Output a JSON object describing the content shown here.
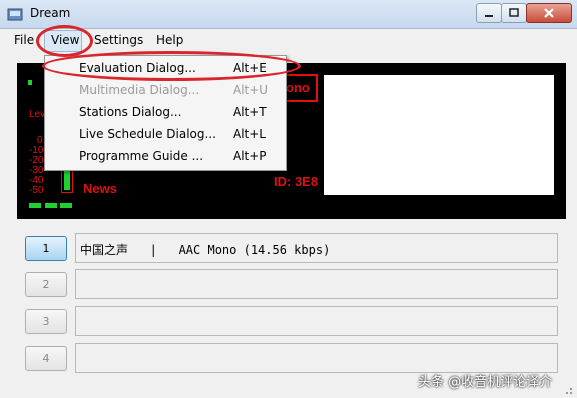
{
  "window": {
    "title": "Dream"
  },
  "menubar": {
    "file": "File",
    "view": "View",
    "settings": "Settings",
    "help": "Help"
  },
  "view_menu": {
    "items": [
      {
        "label": "Evaluation Dialog...",
        "shortcut": "Alt+E",
        "enabled": true,
        "highlighted": true
      },
      {
        "label": "Multimedia Dialog...",
        "shortcut": "Alt+U",
        "enabled": false
      },
      {
        "label": "Stations Dialog...",
        "shortcut": "Alt+T",
        "enabled": true
      },
      {
        "label": "Live Schedule Dialog...",
        "shortcut": "Alt+L",
        "enabled": true
      },
      {
        "label": "Programme Guide ...",
        "shortcut": "Alt+P",
        "enabled": true
      }
    ]
  },
  "display": {
    "level_label": "Lev",
    "scale": [
      "0",
      "-10",
      "-20",
      "-30",
      "-40",
      "-50"
    ],
    "mode": "Mono",
    "mode_visible": "ono",
    "genre": "News",
    "id": "ID: 3E8",
    "colors": {
      "background": "#000000",
      "text": "#e01010",
      "led": "#20d030"
    }
  },
  "channels": [
    {
      "number": "1",
      "text": "中国之声   |   AAC Mono (14.56 kbps)",
      "active": true
    },
    {
      "number": "2",
      "text": "",
      "active": false
    },
    {
      "number": "3",
      "text": "",
      "active": false
    },
    {
      "number": "4",
      "text": "",
      "active": false
    }
  ],
  "watermark": "头条 @收音机评论译介"
}
